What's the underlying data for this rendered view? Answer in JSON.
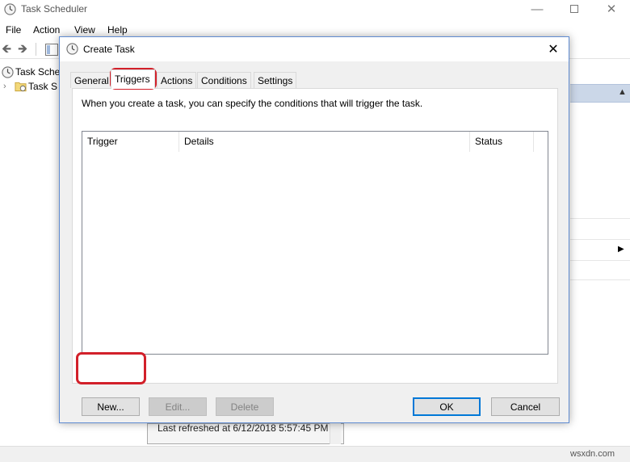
{
  "main_window": {
    "title": "Task Scheduler",
    "menu": [
      "File",
      "Action",
      "View",
      "Help"
    ],
    "tree": [
      {
        "label": "Task Sche"
      },
      {
        "label": "Task S"
      }
    ],
    "status_text": "Last refreshed at 6/12/2018 5:57:45 PM"
  },
  "dialog": {
    "title": "Create Task",
    "tabs": [
      "General",
      "Triggers",
      "Actions",
      "Conditions",
      "Settings"
    ],
    "active_tab": "Triggers",
    "description": "When you create a task, you can specify the conditions that will trigger the task.",
    "list_columns": [
      "Trigger",
      "Details",
      "Status"
    ],
    "buttons": {
      "new": "New...",
      "edit": "Edit...",
      "delete": "Delete",
      "ok": "OK",
      "cancel": "Cancel"
    }
  },
  "watermark": "wsxdn.com",
  "colors": {
    "highlight": "#d2202a",
    "accent": "#0078d7",
    "right_pane_header": "#cbd7e8"
  }
}
